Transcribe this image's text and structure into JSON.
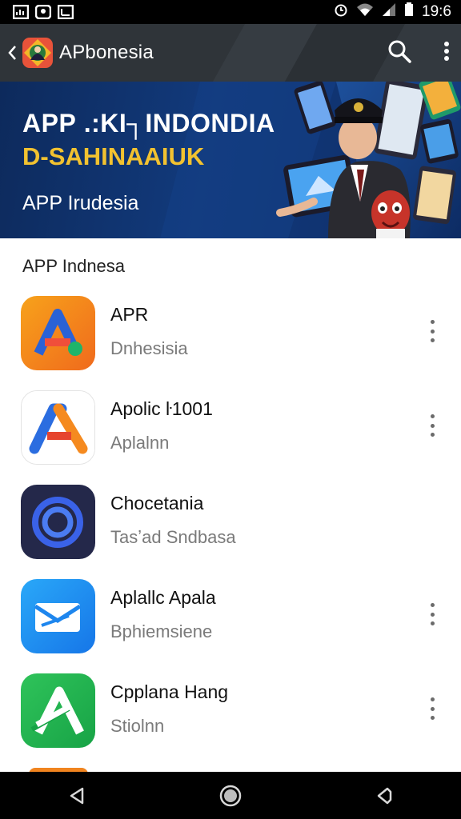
{
  "status_bar": {
    "left_icons": [
      "gallery-icon",
      "app-notification-icon",
      "image-icon"
    ],
    "right_icons": [
      "alarm-icon",
      "wifi-icon",
      "signal-icon",
      "battery-icon"
    ],
    "time": "19:6"
  },
  "app_bar": {
    "title": "APbonesia",
    "actions": [
      "search-icon",
      "more-vert-icon"
    ]
  },
  "banner": {
    "headline": "APP .:KI┐INDONDIA",
    "headline2": "D-SAHINAAIUK",
    "subtitle": "APP Irudesia"
  },
  "section": {
    "title": "APP Indnesa"
  },
  "apps": [
    {
      "title": "APR",
      "subtitle": "Dnhesisia",
      "icon": "orange-a-icon"
    },
    {
      "title": "Apolic ŀ1001",
      "subtitle": "Aplalnn",
      "icon": "white-a-icon"
    },
    {
      "title": "Chocetania",
      "subtitle": "Tasʼad Sndbasa",
      "icon": "blue-ring-icon"
    },
    {
      "title": "Aplallc Apala",
      "subtitle": "Bphiemsiene",
      "icon": "mail-icon"
    },
    {
      "title": "Cpplana Hang",
      "subtitle": "Stiolnn",
      "icon": "green-a-icon"
    }
  ],
  "colors": {
    "app_bar": "#2f3439",
    "banner": "#123a7c",
    "accent_yellow": "#f2c230"
  },
  "nav_bar": [
    "back-triangle-icon",
    "home-circle-icon",
    "recents-icon"
  ]
}
